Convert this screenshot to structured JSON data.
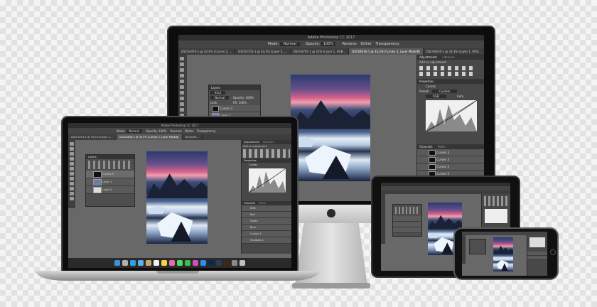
{
  "app": {
    "title": "Adobe Photoshop CC 2017",
    "window_title_short": "Adobe Photoshop CC 2017"
  },
  "options_bar": {
    "mode_label": "Mode:",
    "mode_value": "Normal",
    "opacity_label": "Opacity:",
    "opacity_value": "100%",
    "reverse": "Reverse",
    "dither": "Dither",
    "transparency": "Transparency"
  },
  "doc_tabs": [
    "DSC04470-1 @ 33,3% (Curves 3, ...",
    "DSC04701-1 @ 33,3% (Layer 3, ...",
    "DSC04701-1 @ 25% (Layer 1, RGB...",
    "DSC04616-1 @ 33,3% (Curves 3, Layer Mask/8)",
    "DSC04616-1 @ 33,3% (Layer 1, RGB..."
  ],
  "laptop_tabs": [
    "DSC04701-1 @ 33,3% (Layer 1,...",
    "DSC04616-1 @ 33,3% (Curves 3, Layer Mask/8)",
    "DSC0461..."
  ],
  "layers_panel": {
    "title": "Layers",
    "kind": "Kind",
    "blend": "Normal",
    "opacity": "Opacity: 100%",
    "lock": "Lock:",
    "fill": "Fill: 100%",
    "layers": [
      "Curves 3",
      "Layer 1",
      "Layer 0"
    ]
  },
  "adjustments_panel": {
    "tab1": "Adjustments",
    "tab2": "Libraries",
    "add": "Add an adjustment"
  },
  "properties_panel": {
    "title": "Properties",
    "curves": "Curves",
    "preset": "Preset:",
    "preset_value": "Custom",
    "channel": "RGB",
    "auto": "Auto"
  },
  "channels_panel": {
    "tab1": "Channels",
    "tab2": "Paths",
    "rows": [
      "Curves 3",
      "Curves 3",
      "Curves 3",
      "Curves 3"
    ],
    "laptop_rows": [
      "RGB",
      "Red",
      "Green",
      "Blue",
      "Curves 3",
      "Shadows 1"
    ]
  },
  "colors": {
    "ps_gray": "#686868",
    "panel": "#484848",
    "bezel": "#0d0d0d",
    "silver": "#c9c9c9"
  },
  "devices": [
    "desktop",
    "laptop",
    "tablet",
    "phone"
  ]
}
